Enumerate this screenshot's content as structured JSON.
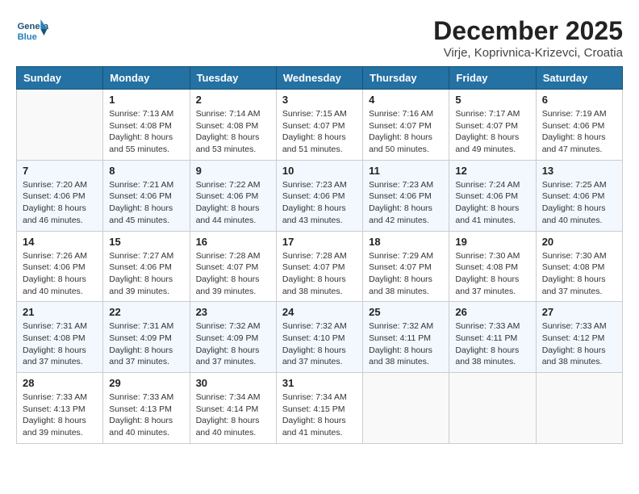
{
  "header": {
    "logo_general": "General",
    "logo_blue": "Blue",
    "month_title": "December 2025",
    "location": "Virje, Koprivnica-Krizevci, Croatia"
  },
  "weekdays": [
    "Sunday",
    "Monday",
    "Tuesday",
    "Wednesday",
    "Thursday",
    "Friday",
    "Saturday"
  ],
  "weeks": [
    [
      {
        "day": "",
        "info": ""
      },
      {
        "day": "1",
        "info": "Sunrise: 7:13 AM\nSunset: 4:08 PM\nDaylight: 8 hours\nand 55 minutes."
      },
      {
        "day": "2",
        "info": "Sunrise: 7:14 AM\nSunset: 4:08 PM\nDaylight: 8 hours\nand 53 minutes."
      },
      {
        "day": "3",
        "info": "Sunrise: 7:15 AM\nSunset: 4:07 PM\nDaylight: 8 hours\nand 51 minutes."
      },
      {
        "day": "4",
        "info": "Sunrise: 7:16 AM\nSunset: 4:07 PM\nDaylight: 8 hours\nand 50 minutes."
      },
      {
        "day": "5",
        "info": "Sunrise: 7:17 AM\nSunset: 4:07 PM\nDaylight: 8 hours\nand 49 minutes."
      },
      {
        "day": "6",
        "info": "Sunrise: 7:19 AM\nSunset: 4:06 PM\nDaylight: 8 hours\nand 47 minutes."
      }
    ],
    [
      {
        "day": "7",
        "info": "Sunrise: 7:20 AM\nSunset: 4:06 PM\nDaylight: 8 hours\nand 46 minutes."
      },
      {
        "day": "8",
        "info": "Sunrise: 7:21 AM\nSunset: 4:06 PM\nDaylight: 8 hours\nand 45 minutes."
      },
      {
        "day": "9",
        "info": "Sunrise: 7:22 AM\nSunset: 4:06 PM\nDaylight: 8 hours\nand 44 minutes."
      },
      {
        "day": "10",
        "info": "Sunrise: 7:23 AM\nSunset: 4:06 PM\nDaylight: 8 hours\nand 43 minutes."
      },
      {
        "day": "11",
        "info": "Sunrise: 7:23 AM\nSunset: 4:06 PM\nDaylight: 8 hours\nand 42 minutes."
      },
      {
        "day": "12",
        "info": "Sunrise: 7:24 AM\nSunset: 4:06 PM\nDaylight: 8 hours\nand 41 minutes."
      },
      {
        "day": "13",
        "info": "Sunrise: 7:25 AM\nSunset: 4:06 PM\nDaylight: 8 hours\nand 40 minutes."
      }
    ],
    [
      {
        "day": "14",
        "info": "Sunrise: 7:26 AM\nSunset: 4:06 PM\nDaylight: 8 hours\nand 40 minutes."
      },
      {
        "day": "15",
        "info": "Sunrise: 7:27 AM\nSunset: 4:06 PM\nDaylight: 8 hours\nand 39 minutes."
      },
      {
        "day": "16",
        "info": "Sunrise: 7:28 AM\nSunset: 4:07 PM\nDaylight: 8 hours\nand 39 minutes."
      },
      {
        "day": "17",
        "info": "Sunrise: 7:28 AM\nSunset: 4:07 PM\nDaylight: 8 hours\nand 38 minutes."
      },
      {
        "day": "18",
        "info": "Sunrise: 7:29 AM\nSunset: 4:07 PM\nDaylight: 8 hours\nand 38 minutes."
      },
      {
        "day": "19",
        "info": "Sunrise: 7:30 AM\nSunset: 4:08 PM\nDaylight: 8 hours\nand 37 minutes."
      },
      {
        "day": "20",
        "info": "Sunrise: 7:30 AM\nSunset: 4:08 PM\nDaylight: 8 hours\nand 37 minutes."
      }
    ],
    [
      {
        "day": "21",
        "info": "Sunrise: 7:31 AM\nSunset: 4:08 PM\nDaylight: 8 hours\nand 37 minutes."
      },
      {
        "day": "22",
        "info": "Sunrise: 7:31 AM\nSunset: 4:09 PM\nDaylight: 8 hours\nand 37 minutes."
      },
      {
        "day": "23",
        "info": "Sunrise: 7:32 AM\nSunset: 4:09 PM\nDaylight: 8 hours\nand 37 minutes."
      },
      {
        "day": "24",
        "info": "Sunrise: 7:32 AM\nSunset: 4:10 PM\nDaylight: 8 hours\nand 37 minutes."
      },
      {
        "day": "25",
        "info": "Sunrise: 7:32 AM\nSunset: 4:11 PM\nDaylight: 8 hours\nand 38 minutes."
      },
      {
        "day": "26",
        "info": "Sunrise: 7:33 AM\nSunset: 4:11 PM\nDaylight: 8 hours\nand 38 minutes."
      },
      {
        "day": "27",
        "info": "Sunrise: 7:33 AM\nSunset: 4:12 PM\nDaylight: 8 hours\nand 38 minutes."
      }
    ],
    [
      {
        "day": "28",
        "info": "Sunrise: 7:33 AM\nSunset: 4:13 PM\nDaylight: 8 hours\nand 39 minutes."
      },
      {
        "day": "29",
        "info": "Sunrise: 7:33 AM\nSunset: 4:13 PM\nDaylight: 8 hours\nand 40 minutes."
      },
      {
        "day": "30",
        "info": "Sunrise: 7:34 AM\nSunset: 4:14 PM\nDaylight: 8 hours\nand 40 minutes."
      },
      {
        "day": "31",
        "info": "Sunrise: 7:34 AM\nSunset: 4:15 PM\nDaylight: 8 hours\nand 41 minutes."
      },
      {
        "day": "",
        "info": ""
      },
      {
        "day": "",
        "info": ""
      },
      {
        "day": "",
        "info": ""
      }
    ]
  ]
}
